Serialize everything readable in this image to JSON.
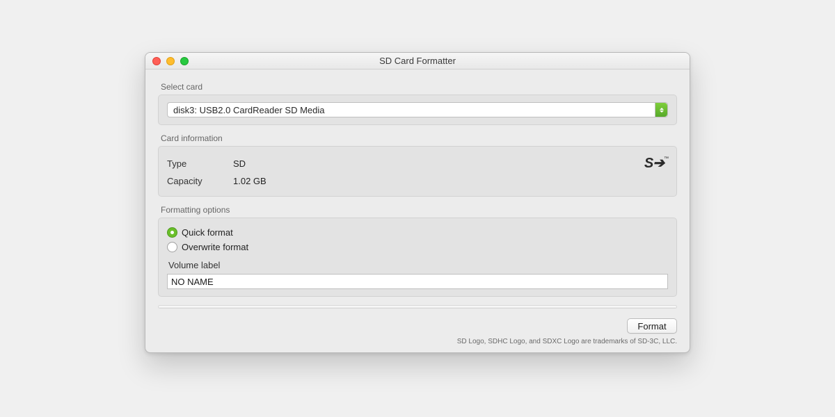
{
  "window": {
    "title": "SD Card Formatter"
  },
  "select_card": {
    "group_label": "Select card",
    "value": "disk3: USB2.0 CardReader SD Media"
  },
  "card_info": {
    "group_label": "Card information",
    "rows": [
      {
        "label": "Type",
        "value": "SD"
      },
      {
        "label": "Capacity",
        "value": "1.02 GB"
      }
    ],
    "logo_text": "SD",
    "logo_icon": "sd-logo-icon"
  },
  "format_options": {
    "group_label": "Formatting options",
    "radios": [
      {
        "label": "Quick format",
        "checked": true
      },
      {
        "label": "Overwrite format",
        "checked": false
      }
    ],
    "volume_label_caption": "Volume label",
    "volume_label_value": "NO NAME"
  },
  "buttons": {
    "format": "Format"
  },
  "footer_legal": "SD Logo, SDHC Logo, and SDXC Logo are trademarks of SD-3C, LLC."
}
